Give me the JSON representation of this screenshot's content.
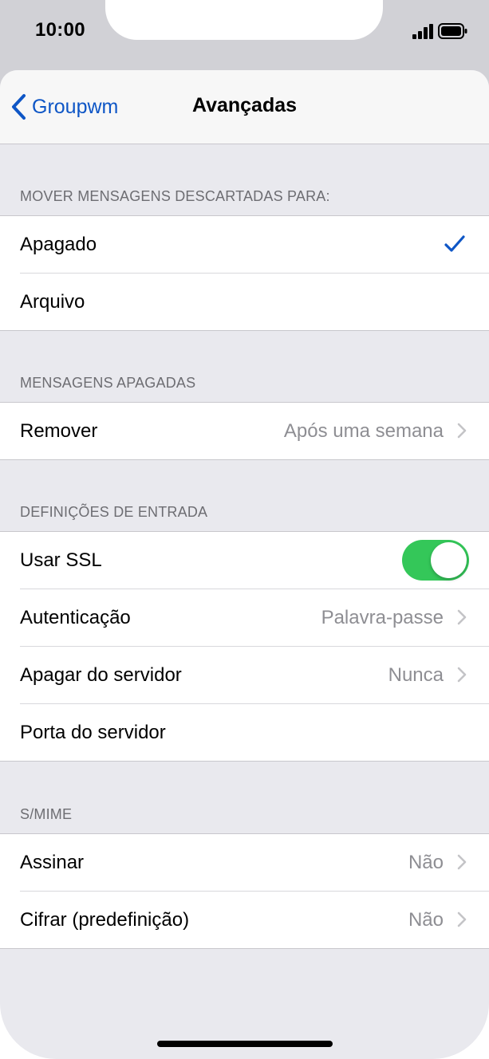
{
  "status_bar": {
    "time": "10:00",
    "signal_icon": "signal-bars-icon",
    "battery_icon": "battery-icon"
  },
  "nav": {
    "back_label": "Groupwm",
    "title": "Avançadas",
    "back_icon": "chevron-left-icon"
  },
  "sections": [
    {
      "header": "MOVER MENSAGENS DESCARTADAS PARA:",
      "rows": [
        {
          "label": "Apagado",
          "checked": true
        },
        {
          "label": "Arquivo",
          "checked": false
        }
      ]
    },
    {
      "header": "MENSAGENS APAGADAS",
      "rows": [
        {
          "label": "Remover",
          "value": "Após uma semana"
        }
      ]
    },
    {
      "header": "DEFINIÇÕES DE ENTRADA",
      "rows": [
        {
          "label": "Usar SSL",
          "toggle_on": true
        },
        {
          "label": "Autenticação",
          "value": "Palavra-passe"
        },
        {
          "label": "Apagar do servidor",
          "value": "Nunca"
        },
        {
          "label": "Porta do servidor",
          "value": ""
        }
      ]
    },
    {
      "header": "S/MIME",
      "rows": [
        {
          "label": "Assinar",
          "value": "Não"
        },
        {
          "label": "Cifrar (predefinição)",
          "value": "Não"
        }
      ]
    }
  ],
  "colors": {
    "accent": "#0e56c6",
    "toggle_on": "#34c759",
    "background": "#e9e9ee",
    "secondary_text": "#8e8e93"
  }
}
